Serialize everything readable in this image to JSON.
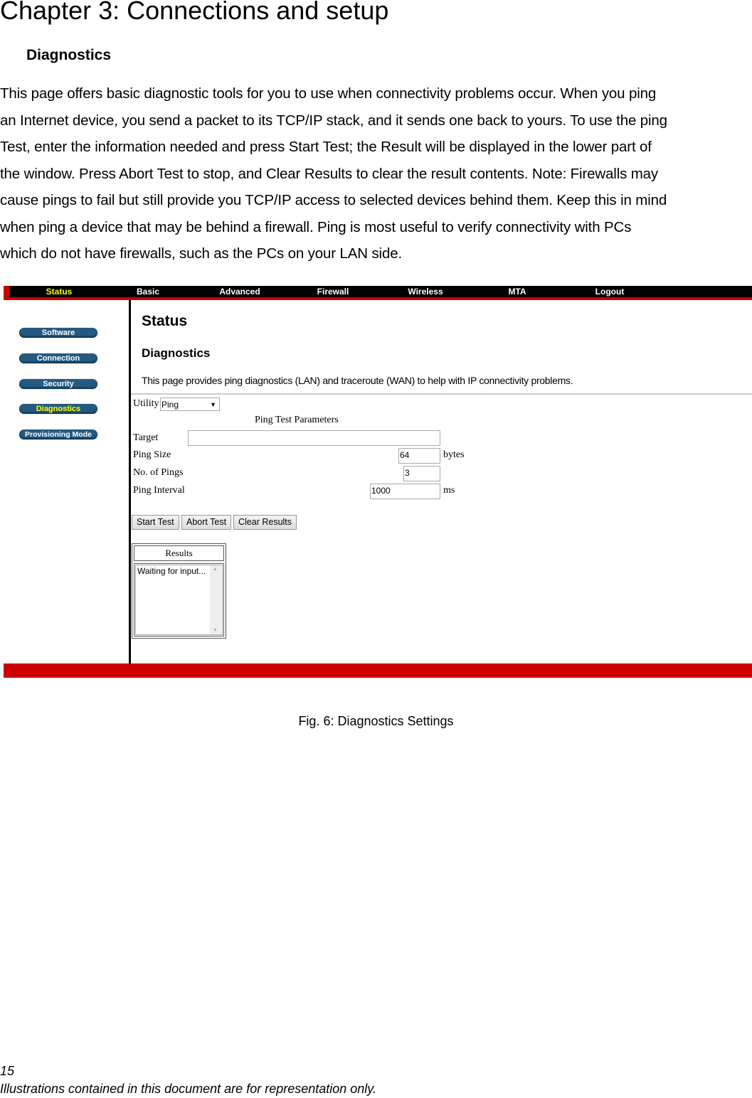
{
  "document": {
    "chapter_title": "Chapter 3: Connections and setup",
    "section_title": "Diagnostics",
    "paragraph_lines": [
      "This page offers basic diagnostic tools for you to use when connectivity problems occur. When you ping",
      "an Internet device, you send a packet to its TCP/IP stack, and it sends one back to yours. To use the ping",
      "Test, enter the information needed and press Start Test; the Result will be displayed in the lower part of",
      "the window. Press Abort Test to stop, and Clear Results to clear the result contents. Note: Firewalls may",
      "cause pings to fail but still provide you TCP/IP access to selected devices behind them. Keep this in mind",
      "when ping a device that may be behind a firewall. Ping is most useful to verify connectivity with PCs",
      "which do not have firewalls, such as the PCs on your LAN side."
    ],
    "figure_caption": "Fig. 6: Diagnostics Settings",
    "page_number": "15",
    "disclaimer": "Illustrations contained in this document are for representation only."
  },
  "router_ui": {
    "colors": {
      "nav_bg": "#000000",
      "accent_red": "#cc0000",
      "active_text": "#ffff00",
      "sidebar_button": "#245a80"
    },
    "nav": [
      {
        "label": "Status",
        "active": true
      },
      {
        "label": "Basic"
      },
      {
        "label": "Advanced"
      },
      {
        "label": "Firewall"
      },
      {
        "label": "Wireless"
      },
      {
        "label": "MTA"
      },
      {
        "label": "Logout"
      }
    ],
    "sidebar": [
      {
        "label": "Software"
      },
      {
        "label": "Connection"
      },
      {
        "label": "Security"
      },
      {
        "label": "Diagnostics",
        "active": true
      },
      {
        "label": "Provisioning Mode"
      }
    ],
    "page_title": "Status",
    "page_subtitle": "Diagnostics",
    "description": "This page provides ping diagnostics (LAN) and traceroute (WAN) to help with IP connectivity problems.",
    "form": {
      "utility_label": "Utility",
      "utility_value": "Ping",
      "params_heading": "Ping Test Parameters",
      "target_label": "Target",
      "target_value": "",
      "ping_size_label": "Ping Size",
      "ping_size_value": "64",
      "ping_size_unit": "bytes",
      "num_pings_label": "No. of Pings",
      "num_pings_value": "3",
      "interval_label": "Ping Interval",
      "interval_value": "1000",
      "interval_unit": "ms"
    },
    "buttons": {
      "start": "Start Test",
      "abort": "Abort Test",
      "clear": "Clear Results"
    },
    "results": {
      "heading": "Results",
      "text": "Waiting for input..."
    }
  }
}
